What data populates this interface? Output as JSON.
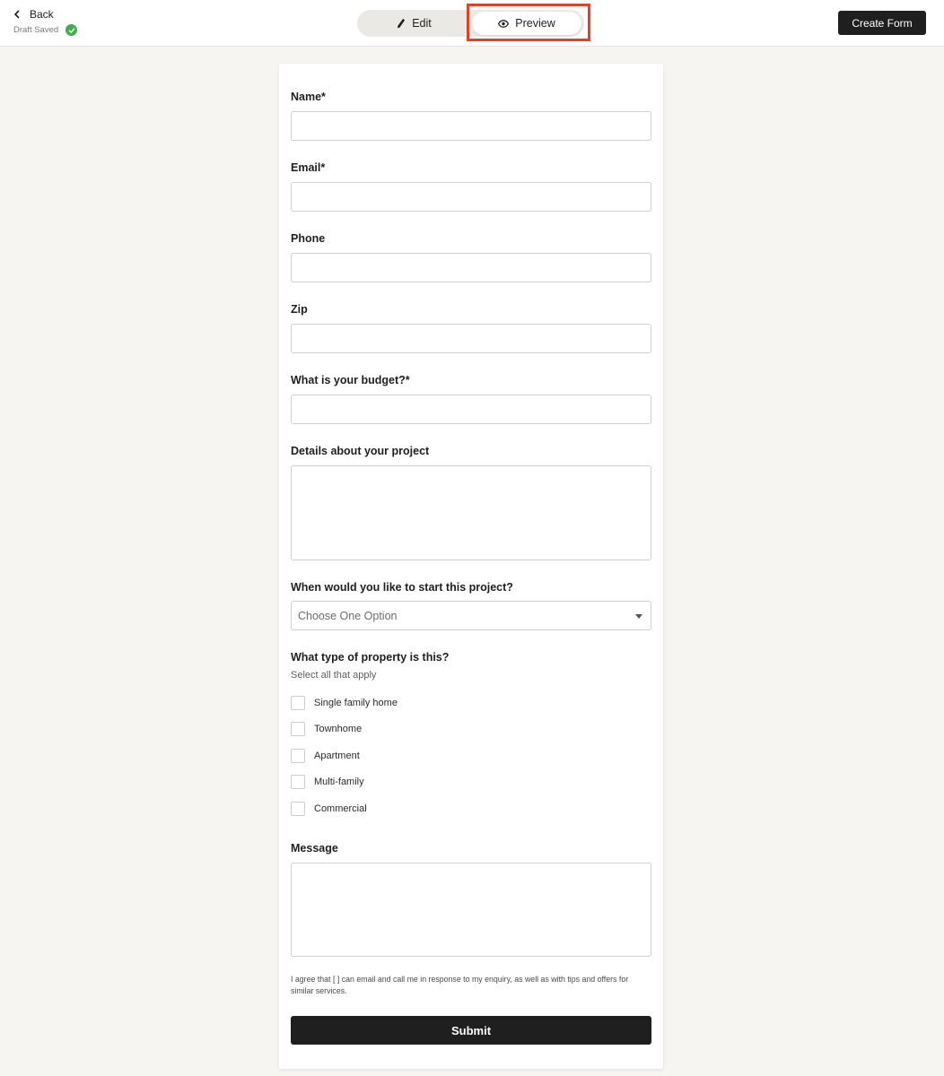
{
  "header": {
    "back_label": "Back",
    "draft_status": "Draft Saved",
    "tabs": [
      {
        "label": "Edit",
        "icon": "pencil-icon"
      },
      {
        "label": "Preview",
        "icon": "eye-icon",
        "active": true
      }
    ],
    "create_label": "Create Form"
  },
  "form": {
    "fields": [
      {
        "label": "Name*"
      },
      {
        "label": "Email*"
      },
      {
        "label": "Phone"
      },
      {
        "label": "Zip"
      },
      {
        "label": "What is your budget?*"
      },
      {
        "label": "Details about your project"
      }
    ],
    "start": {
      "label": "When would you like to start this project?",
      "selected": "Choose One Option"
    },
    "property": {
      "label": "What type of property is this?",
      "hint": "Select all that apply",
      "options": [
        "Single family home",
        "Townhome",
        "Apartment",
        "Multi-family",
        "Commercial"
      ]
    },
    "message": {
      "label": "Message"
    },
    "consent": "I agree that [ ] can email and call me in response to my enquiry, as well as with tips and offers for similar services.",
    "submit_label": "Submit"
  },
  "colors": {
    "accent": "#1f1f1f",
    "highlight": "#e1402b",
    "success": "#3fae49",
    "background": "#f6f5f2"
  }
}
